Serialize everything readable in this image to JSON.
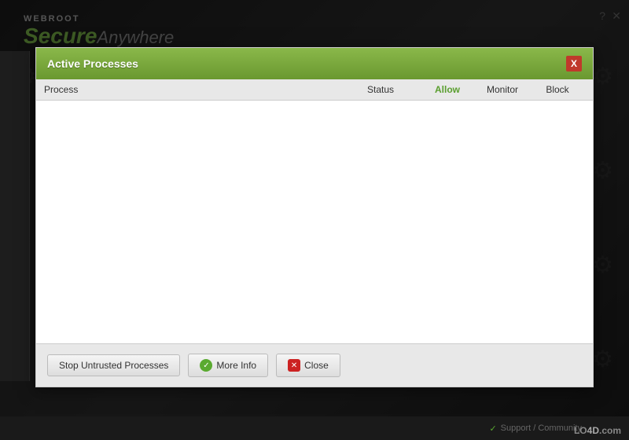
{
  "background": {
    "logo_top": "WEBROOT",
    "logo_secure": "Secure",
    "logo_anywhere": "Anywhere"
  },
  "corner": {
    "question_mark": "?",
    "close_x": "✕"
  },
  "dialog": {
    "title": "Active Processes",
    "close_label": "X",
    "table": {
      "columns": [
        {
          "key": "process",
          "label": "Process"
        },
        {
          "key": "status",
          "label": "Status"
        },
        {
          "key": "allow",
          "label": "Allow"
        },
        {
          "key": "monitor",
          "label": "Monitor"
        },
        {
          "key": "block",
          "label": "Block"
        }
      ],
      "rows": []
    },
    "footer": {
      "stop_button_label": "Stop Untrusted Processes",
      "more_info_button_label": "More Info",
      "close_button_label": "Close"
    }
  },
  "bottom_bar": {
    "support_text": "Support / Community"
  },
  "watermark": {
    "text": "LO4D.com"
  }
}
